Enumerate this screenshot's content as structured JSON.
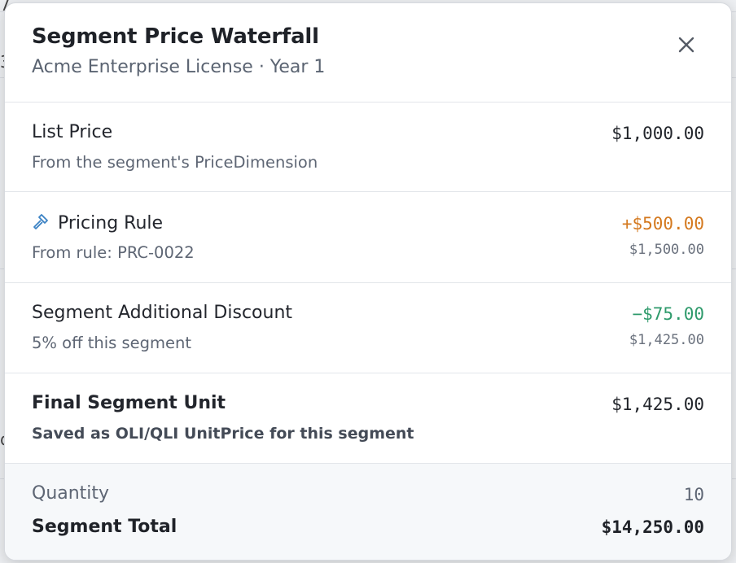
{
  "modal": {
    "title": "Segment Price Waterfall",
    "subtitle": "Acme Enterprise License · Year 1",
    "close_icon": "close-icon"
  },
  "rows": [
    {
      "label": "List Price",
      "sub": "From the segment's PriceDimension",
      "amount": "$1,000.00",
      "running": ""
    },
    {
      "label": "Pricing Rule",
      "icon": "gavel-icon",
      "sub": "From rule: PRC-0022",
      "amount": "+$500.00",
      "amount_color": "#d4791f",
      "running": "$1,500.00"
    },
    {
      "label": "Segment Additional Discount",
      "sub": "5% off this segment",
      "amount": "−$75.00",
      "amount_color": "#2e9a6b",
      "running": "$1,425.00"
    },
    {
      "label": "Final Segment Unit",
      "sub": "Saved as OLI/QLI UnitPrice for this segment",
      "amount": "$1,425.00",
      "running": ""
    }
  ],
  "footer": {
    "quantity_label": "Quantity",
    "quantity_value": "10",
    "total_label": "Segment Total",
    "total_value": "$14,250.00"
  }
}
